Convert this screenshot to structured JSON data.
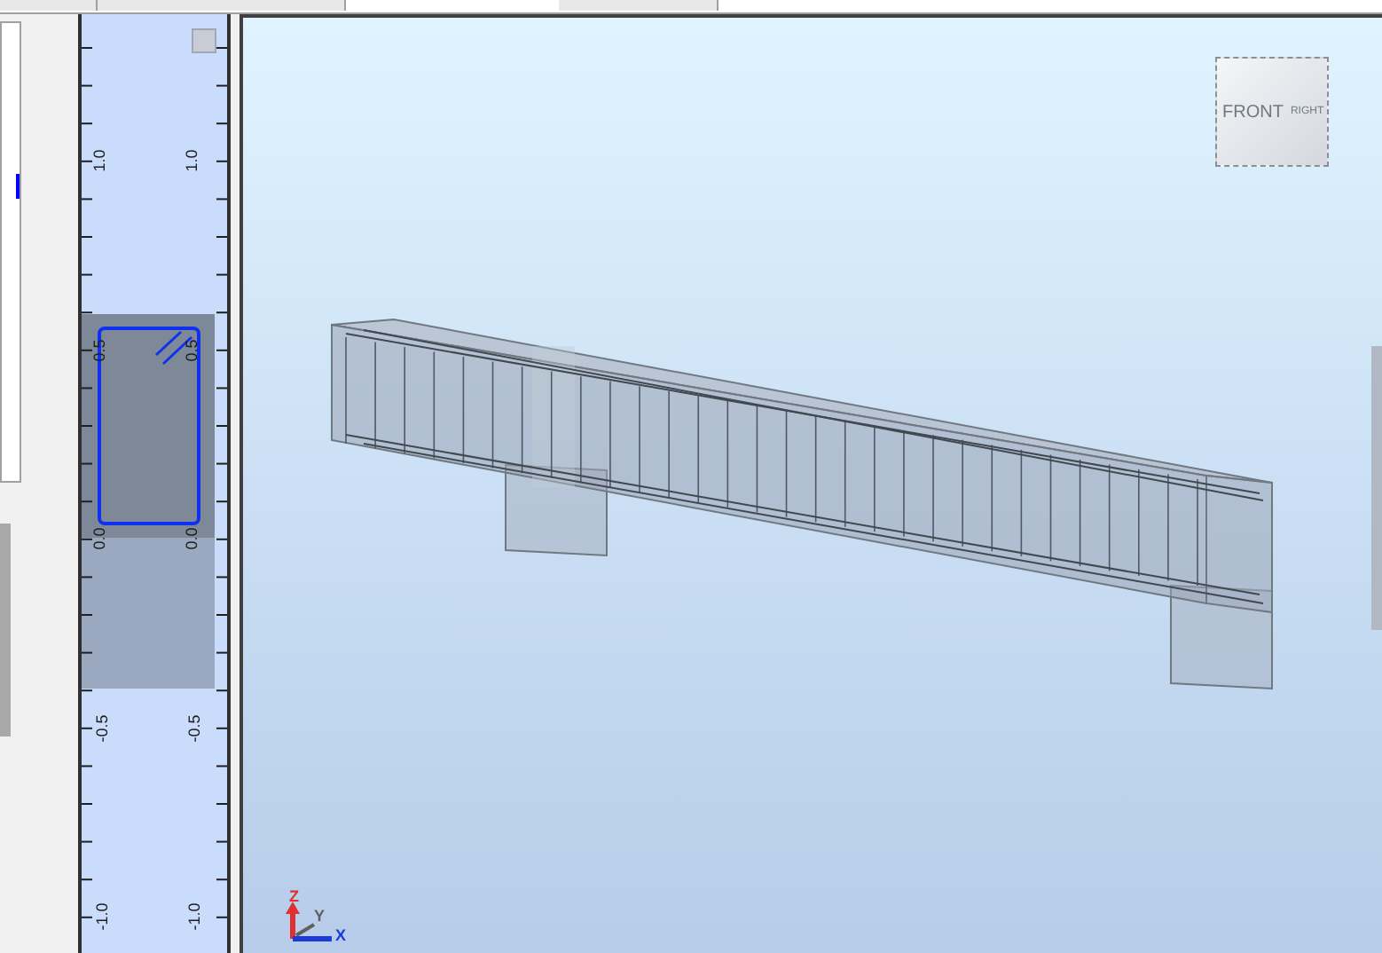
{
  "section_panel": {
    "left_ruler": [
      "1.0",
      "0.5",
      "0.0",
      "-0.5",
      "-1.0"
    ],
    "right_ruler": [
      "1.0",
      "0.5",
      "0.0",
      "-0.5",
      "-1.0"
    ]
  },
  "viewport": {
    "view_cube": {
      "faces": [
        "FRONT",
        "RIGHT"
      ]
    },
    "axis_triad": {
      "labels": [
        "Z",
        "Y",
        "X"
      ]
    }
  }
}
